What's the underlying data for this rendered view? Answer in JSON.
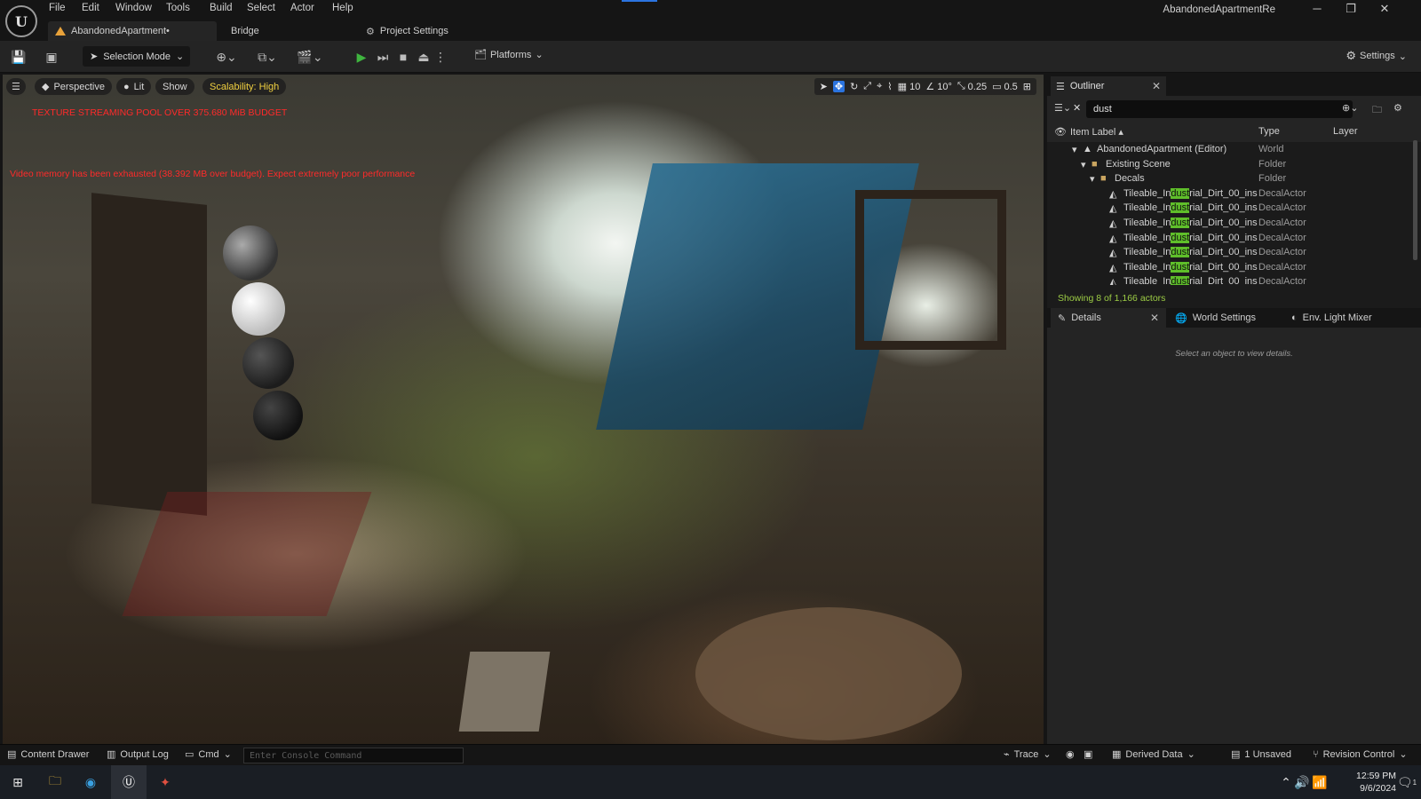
{
  "menu": [
    "File",
    "Edit",
    "Window",
    "Tools",
    "Build",
    "Select",
    "Actor",
    "Help"
  ],
  "window": {
    "project_name": "AbandonedApartmentRe"
  },
  "doc_tabs": {
    "main": "AbandonedApartment•",
    "bridge": "Bridge",
    "project_settings": "Project Settings"
  },
  "toolbar": {
    "selection_mode": "Selection Mode",
    "platforms": "Platforms",
    "settings": "Settings"
  },
  "viewport": {
    "perspective": "Perspective",
    "lit": "Lit",
    "show": "Show",
    "scalability": "Scalability: High",
    "grid_snap": "10",
    "rotation_snap": "10°",
    "scale_snap": "0.25",
    "camera_speed": "0.5",
    "warning_texture": "TEXTURE STREAMING POOL OVER 375.680 MiB BUDGET",
    "warning_video": "Video memory has been exhausted (38.392 MB over budget). Expect extremely poor performance"
  },
  "outliner": {
    "tab_label": "Outliner",
    "search_value": "dust",
    "columns": {
      "label": "Item Label",
      "type": "Type",
      "layer": "Layer"
    },
    "rows": [
      {
        "label": "AbandonedApartment (Editor)",
        "type": "World"
      },
      {
        "label": "Existing Scene",
        "type": "Folder"
      },
      {
        "label": "Decals",
        "type": "Folder"
      },
      {
        "pre": "Tileable_In",
        "match": "dust",
        "post": "rial_Dirt_00_ins",
        "type": "DecalActor"
      },
      {
        "pre": "Tileable_In",
        "match": "dust",
        "post": "rial_Dirt_00_ins",
        "type": "DecalActor"
      },
      {
        "pre": "Tileable_In",
        "match": "dust",
        "post": "rial_Dirt_00_ins",
        "type": "DecalActor"
      },
      {
        "pre": "Tileable_In",
        "match": "dust",
        "post": "rial_Dirt_00_ins",
        "type": "DecalActor"
      },
      {
        "pre": "Tileable_In",
        "match": "dust",
        "post": "rial_Dirt_00_ins",
        "type": "DecalActor"
      },
      {
        "pre": "Tileable_In",
        "match": "dust",
        "post": "rial_Dirt_00_ins",
        "type": "DecalActor"
      },
      {
        "pre": "Tileable_In",
        "match": "dust",
        "post": "rial_Dirt_00_ins",
        "type": "DecalActor"
      }
    ],
    "showing": "Showing 8 of 1,166 actors"
  },
  "details": {
    "tab_details": "Details",
    "tab_world_settings": "World Settings",
    "tab_light_mixer": "Env. Light Mixer",
    "hint": "Select an object to view details."
  },
  "statusbar": {
    "content_drawer": "Content Drawer",
    "output_log": "Output Log",
    "cmd": "Cmd",
    "console_placeholder": "Enter Console Command",
    "trace": "Trace",
    "derived_data": "Derived Data",
    "unsaved": "1 Unsaved",
    "revision_control": "Revision Control"
  },
  "taskbar": {
    "time": "12:59 PM",
    "date": "9/6/2024",
    "notification_count": "1"
  },
  "colors": {
    "accent": "#2b74e0",
    "search_highlight": "#5fbf2a",
    "warning_red": "#ff2a2a",
    "scalability_yellow": "#f0d040",
    "play_green": "#3fb53f"
  }
}
